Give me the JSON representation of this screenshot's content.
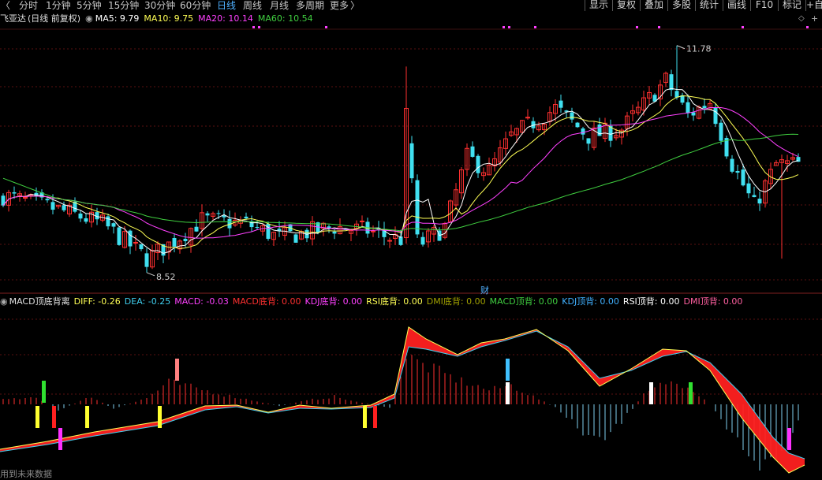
{
  "toolbar": {
    "back_glyph": "〈",
    "periods": [
      "分时",
      "1分钟",
      "5分钟",
      "15分钟",
      "30分钟",
      "60分钟",
      "日线",
      "周线",
      "月线",
      "多周期",
      "更多"
    ],
    "more_glyph": "〉",
    "right_buttons": [
      "显示",
      "复权",
      "叠加",
      "多股",
      "统计",
      "画线",
      "F10",
      "标记",
      "+自"
    ]
  },
  "header": {
    "stock_name": "飞亚达",
    "adjust_mode": "(日线 前复权)",
    "ma": [
      {
        "label": "MA5: 9.79",
        "color": "#ffffff"
      },
      {
        "label": "MA10: 9.75",
        "color": "#ffff55"
      },
      {
        "label": "MA20: 10.14",
        "color": "#ff40ff"
      },
      {
        "label": "MA60: 10.54",
        "color": "#40d040"
      }
    ]
  },
  "main_chart": {
    "high_label": "11.78",
    "low_label": "8.52",
    "fin_flag": "财"
  },
  "indicator": {
    "name": "MACD顶底背离",
    "fields": [
      {
        "label": "DIFF: -0.26",
        "color": "#ffffff"
      },
      {
        "label": "DEA: -0.25",
        "color": "#ffff55"
      },
      {
        "label": "MACD: -0.03",
        "color": "#ff40ff"
      },
      {
        "label": "MACD底背: 0.00",
        "color": "#ff3030"
      },
      {
        "label": "KDJ底背: 0.00",
        "color": "#ff40ff"
      },
      {
        "label": "RSI底背: 0.00",
        "color": "#ffff55"
      },
      {
        "label": "DMI底背: 0.00",
        "color": "#a0a000"
      },
      {
        "label": "MACD顶背: 0.00",
        "color": "#40d040"
      },
      {
        "label": "KDJ顶背: 0.00",
        "color": "#40b0ff"
      },
      {
        "label": "RSI顶背: 0.00",
        "color": "#ffffff"
      },
      {
        "label": "DMI顶背: 0.00",
        "color": "#ff60a0"
      }
    ]
  },
  "footer": {
    "text": "用到未来数据"
  },
  "colors": {
    "up": "#ff3030",
    "down": "#40e0f0",
    "ma5": "#ffffff",
    "ma10": "#ffff55",
    "ma20": "#ff40ff",
    "ma60": "#40d040"
  }
}
